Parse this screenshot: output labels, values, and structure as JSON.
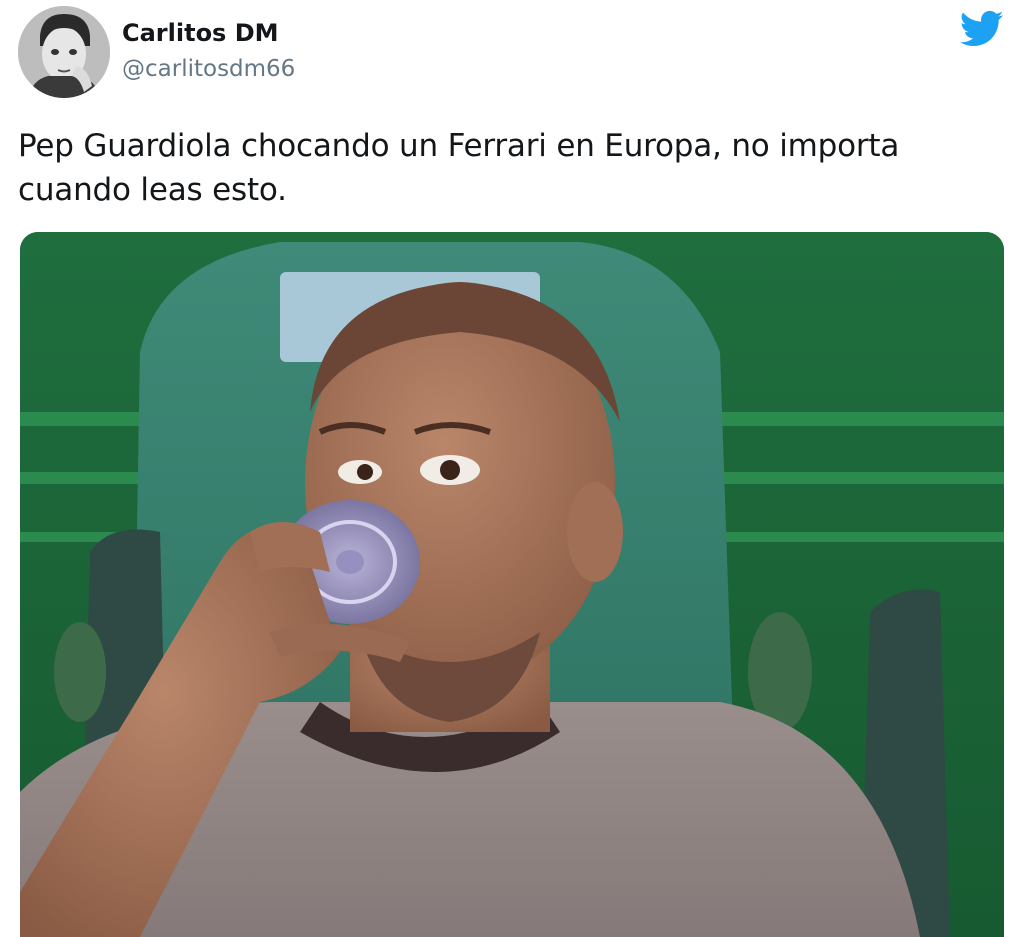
{
  "author": {
    "display_name": "Carlitos DM",
    "handle": "@carlitosdm66",
    "avatar_icon": "profile-photo"
  },
  "brand": {
    "icon": "twitter-bird-icon",
    "color": "#1da1f2"
  },
  "tweet": {
    "text": "Pep Guardiola chocando un Ferrari en Europa, no importa\ncuando leas esto."
  },
  "media": {
    "type": "photo",
    "icon": "photo-man-drinking-water-bottle"
  },
  "colors": {
    "handle": "#657786",
    "text": "#14171a"
  }
}
